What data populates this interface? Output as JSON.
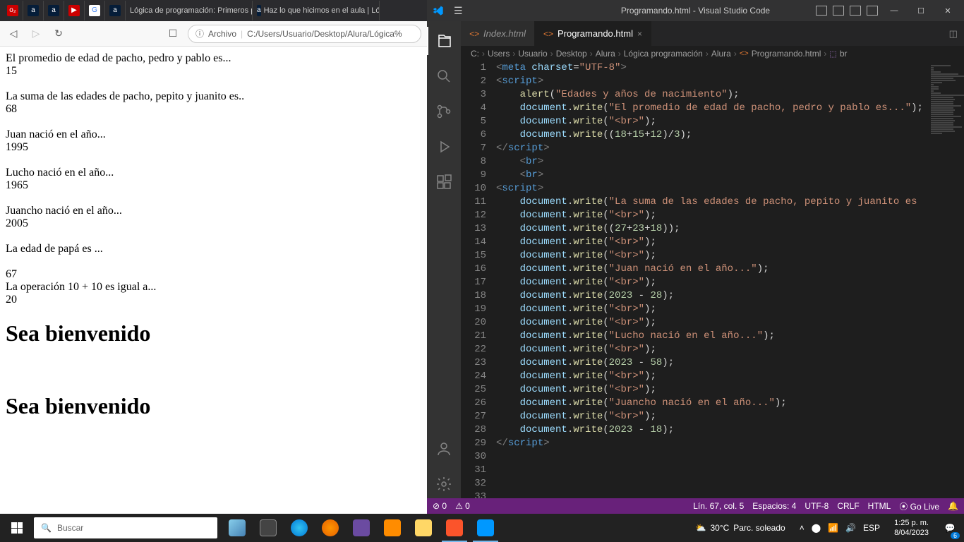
{
  "browser": {
    "tabs": [
      {
        "icon": "o2",
        "label": ""
      },
      {
        "icon": "a",
        "label": ""
      },
      {
        "icon": "a",
        "label": ""
      },
      {
        "icon": "yt",
        "label": ""
      },
      {
        "icon": "G",
        "label": ""
      },
      {
        "icon": "a",
        "label": ""
      },
      {
        "icon": "blank",
        "label": "Lógica de programación: Primeros pa"
      },
      {
        "icon": "a",
        "label": "Haz lo que hicimos en el aula | Ló"
      }
    ],
    "addr_prefix": "Archivo",
    "addr_path": "C:/Users/Usuario/Desktop/Alura/Lógica%"
  },
  "page": {
    "l1": "El promedio de edad de pacho, pedro y pablo es...",
    "v1": "15",
    "l2": "La suma de las edades de pacho, pepito y juanito es..",
    "v2": "68",
    "l3": "Juan nació en el año...",
    "v3": "1995",
    "l4": "Lucho nació en el año...",
    "v4": "1965",
    "l5": "Juancho nació en el año...",
    "v5": "2005",
    "l6": "La edad de papá es ...",
    "v6": "67",
    "l7": "La operación 10 + 10 es igual a...",
    "v7": "20",
    "h1": "Sea bienvenido",
    "h2": "Sea bienvenido"
  },
  "vscode": {
    "title": "Programando.html - Visual Studio Code",
    "tabs": [
      {
        "label": "Index.html",
        "active": false
      },
      {
        "label": "Programando.html",
        "active": true
      }
    ],
    "breadcrumb": [
      "C:",
      "Users",
      "Usuario",
      "Desktop",
      "Alura",
      "Lógica programación",
      "Alura",
      "Programando.html",
      "br"
    ],
    "lines": [
      {
        "n": 1,
        "html": "<span class='tk-tag'>&lt;</span><span class='tk-el'>meta</span> <span class='tk-attr'>charset</span>=<span class='tk-str'>\"UTF-8\"</span><span class='tk-tag'>&gt;</span>"
      },
      {
        "n": 2,
        "html": ""
      },
      {
        "n": 3,
        "html": ""
      },
      {
        "n": 4,
        "html": "<span class='tk-tag'>&lt;</span><span class='tk-el'>script</span><span class='tk-tag'>&gt;</span>"
      },
      {
        "n": 5,
        "html": "    <span class='tk-fn'>alert</span>(<span class='tk-str'>\"Edades y años de nacimiento\"</span>);"
      },
      {
        "n": 6,
        "html": "    <span class='tk-obj'>document</span>.<span class='tk-fn'>write</span>(<span class='tk-str'>\"El promedio de edad de pacho, pedro y pablo es...\"</span>);"
      },
      {
        "n": 7,
        "html": "    <span class='tk-obj'>document</span>.<span class='tk-fn'>write</span>(<span class='tk-str'>\"&lt;br&gt;\"</span>);"
      },
      {
        "n": 8,
        "html": "    <span class='tk-obj'>document</span>.<span class='tk-fn'>write</span>((<span class='tk-num'>18</span>+<span class='tk-num'>15</span>+<span class='tk-num'>12</span>)/<span class='tk-num'>3</span>);"
      },
      {
        "n": 9,
        "html": "<span class='tk-tag'>&lt;/</span><span class='tk-el'>script</span><span class='tk-tag'>&gt;</span>"
      },
      {
        "n": 10,
        "html": ""
      },
      {
        "n": 11,
        "html": "    <span class='tk-tag'>&lt;</span><span class='tk-el'>br</span><span class='tk-tag'>&gt;</span>"
      },
      {
        "n": 12,
        "html": "    <span class='tk-tag'>&lt;</span><span class='tk-el'>br</span><span class='tk-tag'>&gt;</span>"
      },
      {
        "n": 13,
        "html": ""
      },
      {
        "n": 14,
        "html": "<span class='tk-tag'>&lt;</span><span class='tk-el'>script</span><span class='tk-tag'>&gt;</span>"
      },
      {
        "n": 15,
        "html": "    <span class='tk-obj'>document</span>.<span class='tk-fn'>write</span>(<span class='tk-str'>\"La suma de las edades de pacho, pepito y juanito es</span>"
      },
      {
        "n": 16,
        "html": "    <span class='tk-obj'>document</span>.<span class='tk-fn'>write</span>(<span class='tk-str'>\"&lt;br&gt;\"</span>);"
      },
      {
        "n": 17,
        "html": "    <span class='tk-obj'>document</span>.<span class='tk-fn'>write</span>((<span class='tk-num'>27</span>+<span class='tk-num'>23</span>+<span class='tk-num'>18</span>));"
      },
      {
        "n": 18,
        "html": "    <span class='tk-obj'>document</span>.<span class='tk-fn'>write</span>(<span class='tk-str'>\"&lt;br&gt;\"</span>);"
      },
      {
        "n": 19,
        "html": "    <span class='tk-obj'>document</span>.<span class='tk-fn'>write</span>(<span class='tk-str'>\"&lt;br&gt;\"</span>);"
      },
      {
        "n": 20,
        "html": "    <span class='tk-obj'>document</span>.<span class='tk-fn'>write</span>(<span class='tk-str'>\"Juan nació en el año...\"</span>);"
      },
      {
        "n": 21,
        "html": "    <span class='tk-obj'>document</span>.<span class='tk-fn'>write</span>(<span class='tk-str'>\"&lt;br&gt;\"</span>);"
      },
      {
        "n": 22,
        "html": "    <span class='tk-obj'>document</span>.<span class='tk-fn'>write</span>(<span class='tk-num'>2023</span> - <span class='tk-num'>28</span>);"
      },
      {
        "n": 23,
        "html": "    <span class='tk-obj'>document</span>.<span class='tk-fn'>write</span>(<span class='tk-str'>\"&lt;br&gt;\"</span>);"
      },
      {
        "n": 24,
        "html": "    <span class='tk-obj'>document</span>.<span class='tk-fn'>write</span>(<span class='tk-str'>\"&lt;br&gt;\"</span>);"
      },
      {
        "n": 25,
        "html": "    <span class='tk-obj'>document</span>.<span class='tk-fn'>write</span>(<span class='tk-str'>\"Lucho nació en el año...\"</span>);"
      },
      {
        "n": 26,
        "html": "    <span class='tk-obj'>document</span>.<span class='tk-fn'>write</span>(<span class='tk-str'>\"&lt;br&gt;\"</span>);"
      },
      {
        "n": 27,
        "html": "    <span class='tk-obj'>document</span>.<span class='tk-fn'>write</span>(<span class='tk-num'>2023</span> - <span class='tk-num'>58</span>);"
      },
      {
        "n": 28,
        "html": "    <span class='tk-obj'>document</span>.<span class='tk-fn'>write</span>(<span class='tk-str'>\"&lt;br&gt;\"</span>);"
      },
      {
        "n": 29,
        "html": "    <span class='tk-obj'>document</span>.<span class='tk-fn'>write</span>(<span class='tk-str'>\"&lt;br&gt;\"</span>);"
      },
      {
        "n": 30,
        "html": "    <span class='tk-obj'>document</span>.<span class='tk-fn'>write</span>(<span class='tk-str'>\"Juancho nació en el año...\"</span>);"
      },
      {
        "n": 31,
        "html": "    <span class='tk-obj'>document</span>.<span class='tk-fn'>write</span>(<span class='tk-str'>\"&lt;br&gt;\"</span>);"
      },
      {
        "n": 32,
        "html": "    <span class='tk-obj'>document</span>.<span class='tk-fn'>write</span>(<span class='tk-num'>2023</span> - <span class='tk-num'>18</span>);"
      },
      {
        "n": 33,
        "html": "<span class='tk-tag'>&lt;/</span><span class='tk-el'>script</span><span class='tk-tag'>&gt;</span>"
      }
    ],
    "status": {
      "errors": "⊘ 0",
      "warnings": "⚠ 0",
      "cursor": "Lín. 67, col. 5",
      "spaces": "Espacios: 4",
      "encoding": "UTF-8",
      "eol": "CRLF",
      "lang": "HTML",
      "golive": "⦿ Go Live"
    }
  },
  "taskbar": {
    "search_placeholder": "Buscar",
    "weather_temp": "30°C",
    "weather_desc": "Parc. soleado",
    "lang": "ESP",
    "time": "1:25 p. m.",
    "date": "8/04/2023",
    "notif_count": "6"
  }
}
